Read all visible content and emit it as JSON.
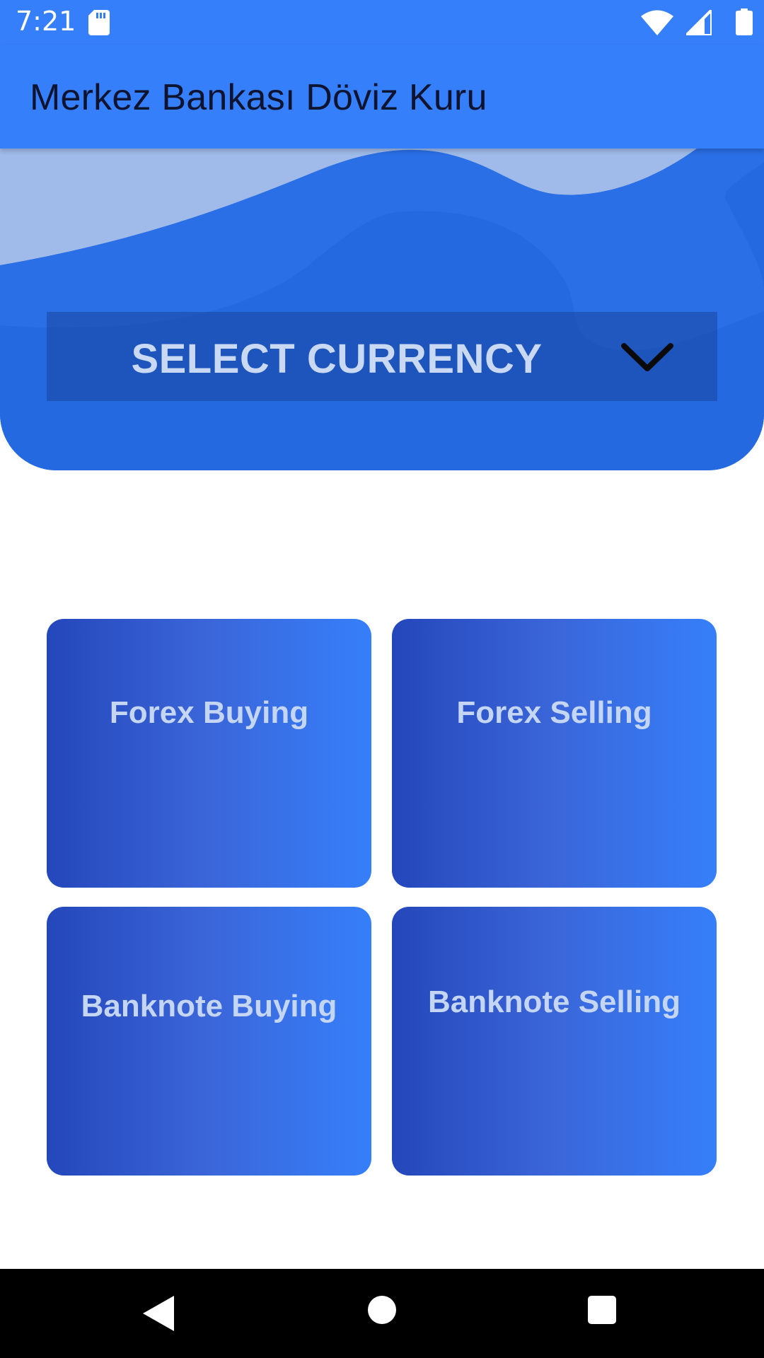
{
  "status_bar": {
    "time": "7:21",
    "icons": [
      "sd-card-icon",
      "wifi-icon",
      "signal-icon",
      "battery-icon"
    ]
  },
  "app_bar": {
    "title": "Merkez Bankası Döviz Kuru"
  },
  "currency_selector": {
    "label": "SELECT CURRENCY",
    "icon": "chevron-down-icon"
  },
  "tiles": [
    {
      "label": "Forex Buying"
    },
    {
      "label": "Forex Selling"
    },
    {
      "label": "Banknote Buying"
    },
    {
      "label": "Banknote Selling"
    }
  ],
  "nav_bar": {
    "icons": [
      "back-icon",
      "home-icon",
      "recents-icon"
    ]
  },
  "colors": {
    "primary": "#367ffa",
    "header_dark": "#2469e0",
    "tile_gradient_start": "#2447bb",
    "tile_gradient_end": "#367ffa",
    "title_text": "#0e1430",
    "light_text": "#c9d8f3"
  }
}
